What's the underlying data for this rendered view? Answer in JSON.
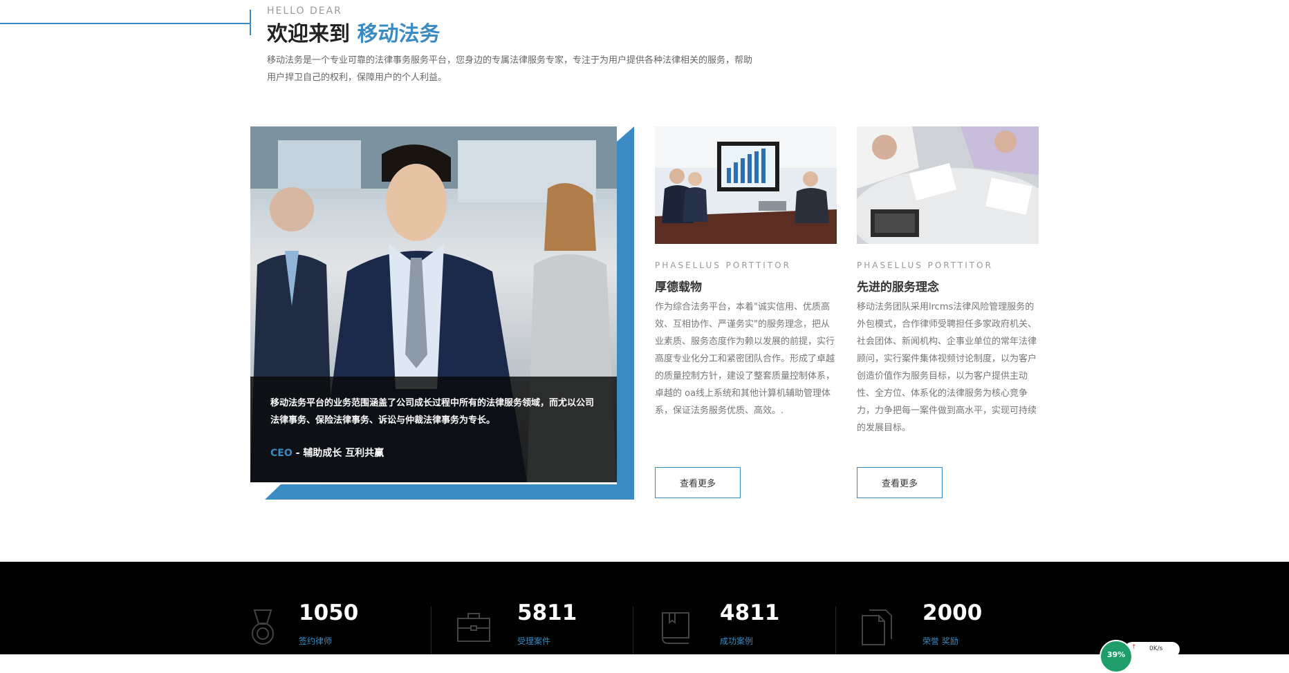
{
  "intro": {
    "hello": "HELLO DEAR",
    "welcome_prefix": "欢迎来到 ",
    "welcome_accent": "移动法务",
    "description": "移动法务是一个专业可靠的法律事务服务平台，您身边的专属法律服务专家，专注于为用户提供各种法律相关的服务，帮助用户捍卫自己的权利，保障用户的个人利益。"
  },
  "feature": {
    "text": "移动法务平台的业务范围涵盖了公司成长过程中所有的法律服务领域，而尤以公司法律事务、保险法律事务、诉讼与仲裁法律事务为专长。",
    "sig_role": "CEO",
    "sig_sep": " - ",
    "sig_motto": "辅助成长 互利共赢"
  },
  "cards": [
    {
      "kicker": "PHASELLUS PORTTITOR",
      "title": "厚德载物",
      "body": "作为综合法务平台，本着\"诚实信用、优质高效、互相协作、严谨务实\"的服务理念，把从业素质、服务态度作为赖以发展的前提，实行高度专业化分工和紧密团队合作。形成了卓越的质量控制方针，建设了整套质量控制体系，卓越的 oa线上系统和其他计算机辅助管理体系，保证法务服务优质、高效。.",
      "button": "查看更多"
    },
    {
      "kicker": "PHASELLUS PORTTITOR",
      "title": "先进的服务理念",
      "body": "移动法务团队采用lrcms法律风险管理服务的外包模式，合作律师受聘担任多家政府机关、社会团体、新闻机构、企事业单位的常年法律顾问，实行案件集体视频讨论制度，以为客户创造价值作为服务目标，以为客户提供主动性、全方位、体系化的法律服务为核心竞争力，力争把每一案件做到高水平，实现可持续的发展目标。",
      "button": "查看更多"
    }
  ],
  "stats": [
    {
      "icon": "medal-icon",
      "value": "1050",
      "label": "签约律师"
    },
    {
      "icon": "briefcase-icon",
      "value": "5811",
      "label": "受理案件"
    },
    {
      "icon": "book-icon",
      "value": "4811",
      "label": "成功案例"
    },
    {
      "icon": "documents-icon",
      "value": "2000",
      "label": "荣誉 奖励"
    }
  ],
  "speed_widget": {
    "percent": "39%",
    "rate": "0K/s"
  },
  "colors": {
    "accent": "#3a8bc4",
    "dark": "#000000"
  }
}
